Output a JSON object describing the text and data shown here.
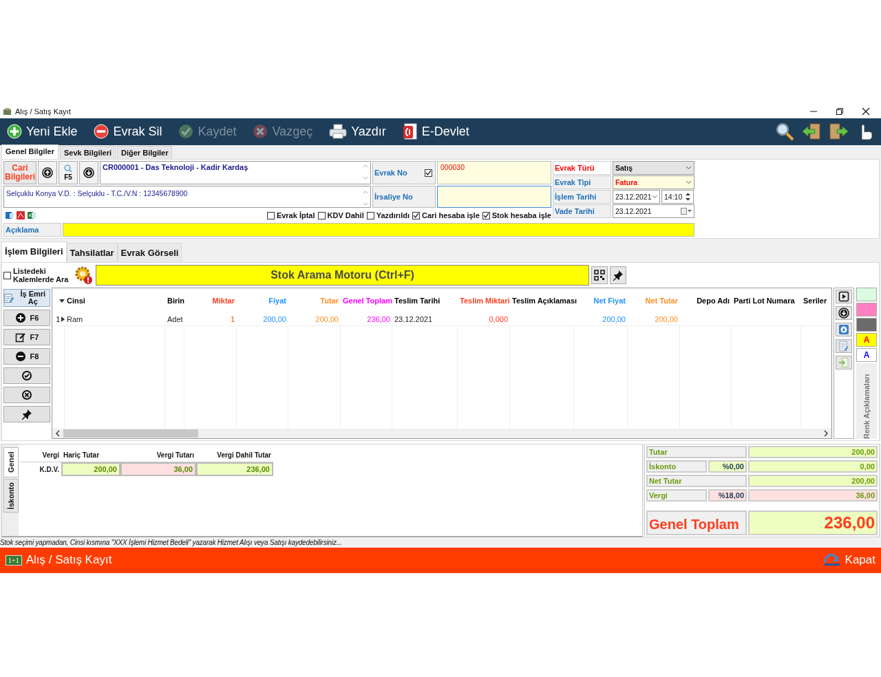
{
  "window": {
    "title": "Alış / Satış Kayıt"
  },
  "toolbar": [
    {
      "label": "Yeni Ekle",
      "kind": "add",
      "disabled": false
    },
    {
      "label": "Evrak Sil",
      "kind": "delete",
      "disabled": false
    },
    {
      "label": "Kaydet",
      "kind": "save",
      "disabled": true
    },
    {
      "label": "Vazgeç",
      "kind": "cancel",
      "disabled": true
    },
    {
      "label": "Yazdır",
      "kind": "print",
      "disabled": false
    },
    {
      "label": "E-Devlet",
      "kind": "edevlet",
      "disabled": false
    }
  ],
  "tabs": [
    {
      "label": "Genel Bilgiler",
      "selected": true
    },
    {
      "label": "Sevk Bilgileri",
      "selected": false
    },
    {
      "label": "Diğer Bilgiler",
      "selected": false
    }
  ],
  "cari": {
    "button": "Cari Bilgileri",
    "search_key": "F5",
    "account": "CR000001 - Das Teknoloji - Kadir Kardaş",
    "tax_info": "Selçuklu Konya V.D. :  Selçuklu - T.C./V.N :  12345678900"
  },
  "evrak_no": {
    "label": "Evrak No",
    "checked": true,
    "value": "000030"
  },
  "irsaliye_no": {
    "label": "İrsaliye No"
  },
  "options": [
    {
      "label": "Evrak İptal",
      "checked": false
    },
    {
      "label": "KDV Dahil",
      "checked": false
    },
    {
      "label": "Yazdırıldı",
      "checked": false
    },
    {
      "label": "Cari hesaba işle",
      "checked": true
    },
    {
      "label": "Stok hesaba işle",
      "checked": true
    }
  ],
  "doc_fields": [
    {
      "label": "Evrak Türü",
      "value": "Satış",
      "kind": "select"
    },
    {
      "label": "Evrak Tipi",
      "value": "Fatura",
      "kind": "select"
    },
    {
      "label": "İşlem Tarihi",
      "value": "23.12.2021",
      "time": "14:10",
      "kind": "datetime"
    },
    {
      "label": "Vade Tarihi",
      "value": "23.12.2021",
      "kind": "date"
    }
  ],
  "aciklama": {
    "label": "Açıklama"
  },
  "detail_tabs": [
    {
      "label": "İşlem Bilgileri",
      "selected": true
    },
    {
      "label": "Tahsilatlar",
      "selected": false
    },
    {
      "label": "Evrak Görseli",
      "selected": false
    }
  ],
  "search": {
    "checkbox_label": "Listedeki Kalemlerde Ara",
    "checked": false,
    "bar": "Stok Arama Motoru (Ctrl+F)"
  },
  "side_buttons": [
    {
      "label": "İş Emri Aç",
      "kind": "workorder"
    },
    {
      "label": "F6",
      "kind": "add"
    },
    {
      "label": "F7",
      "kind": "edit"
    },
    {
      "label": "F8",
      "kind": "remove"
    },
    {
      "kind": "approve"
    },
    {
      "kind": "cancel"
    },
    {
      "kind": "pin"
    }
  ],
  "table": {
    "row_number": "1",
    "columns": [
      {
        "label": "Cinsi",
        "color": "#000000",
        "kind": "text",
        "cell": "Ram"
      },
      {
        "label": "Birin",
        "color": "#000000",
        "kind": "text",
        "cell": "Adet"
      },
      {
        "label": "Miktar",
        "color": "#ff3c1e",
        "kind": "number",
        "cell": "1"
      },
      {
        "label": "Fiyat",
        "color": "#1e90ff",
        "kind": "number",
        "cell": "200,00"
      },
      {
        "label": "Tutar",
        "color": "#ff8c1e",
        "kind": "number",
        "cell": "200,00"
      },
      {
        "label": "Genel Toplam",
        "color": "#ff00ff",
        "kind": "number",
        "cell": "236,00"
      },
      {
        "label": "Teslim Tarihi",
        "color": "#000000",
        "kind": "text",
        "cell": "23.12.2021"
      },
      {
        "label": "Teslim Miktari",
        "color": "#ff3c1e",
        "kind": "number",
        "cell": "0,000"
      },
      {
        "label": "Teslim Açıklaması",
        "color": "#000000",
        "kind": "text"
      },
      {
        "label": "Net Fiyat",
        "color": "#1e90ff",
        "kind": "number",
        "cell": "200,00"
      },
      {
        "label": "Net Tutar",
        "color": "#ff8c1e",
        "kind": "number",
        "cell": "200,00"
      },
      {
        "label": "Depo Adı",
        "color": "#000000",
        "kind": "number"
      },
      {
        "label": "Parti Lot Numara",
        "color": "#000000",
        "kind": "text"
      },
      {
        "label": "Seriler",
        "color": "#000000",
        "kind": "text"
      }
    ]
  },
  "grid_tools": [
    {
      "kind": "play"
    },
    {
      "kind": "down"
    },
    {
      "kind": "download"
    },
    {
      "kind": "note"
    },
    {
      "kind": "import"
    }
  ],
  "color_legend": {
    "title": "Renk Açıklamaları",
    "items": [
      {
        "color": "#d9fbe0"
      },
      {
        "color": "#ff80c0"
      },
      {
        "color": "#6b6b6b"
      },
      {
        "color": "#ffff00",
        "letter": "A"
      },
      {
        "color": "#ffffff",
        "letter": "A"
      }
    ]
  },
  "tax_tabs": [
    {
      "label": "Genel",
      "selected": true
    },
    {
      "label": "İskonto",
      "selected": false
    }
  ],
  "tax_table": {
    "columns": [
      "Vergi",
      "Hariç Tutar",
      "Vergi Tutarı",
      "Vergi Dahil Tutar"
    ],
    "rows": [
      {
        "name": "K.D.V.",
        "base": "200,00",
        "tax": "36,00",
        "total": "236,00"
      }
    ]
  },
  "totals": [
    {
      "label": "Tutar",
      "value": "200,00",
      "kind": "plain"
    },
    {
      "label": "İskonto",
      "rate": "%0,00",
      "value": "0,00",
      "kind": "discount"
    },
    {
      "label": "Net Tutar",
      "value": "200,00",
      "kind": "plain"
    },
    {
      "label": "Vergi",
      "rate": "%18,00",
      "value": "36,00",
      "kind": "tax"
    }
  ],
  "grand_total": {
    "label": "Genel Toplam",
    "value": "236,00"
  },
  "hint": "Stok seçimi yapmadan, Cinsi kısmına \"XXX İşlemi Hizmet Bedeli\" yazarak Hizmet Alışı veya Satışı kaydedebilirsiniz...",
  "footer": {
    "badge": "1+1",
    "title": "Alış / Satış Kayıt",
    "close": "Kapat"
  }
}
